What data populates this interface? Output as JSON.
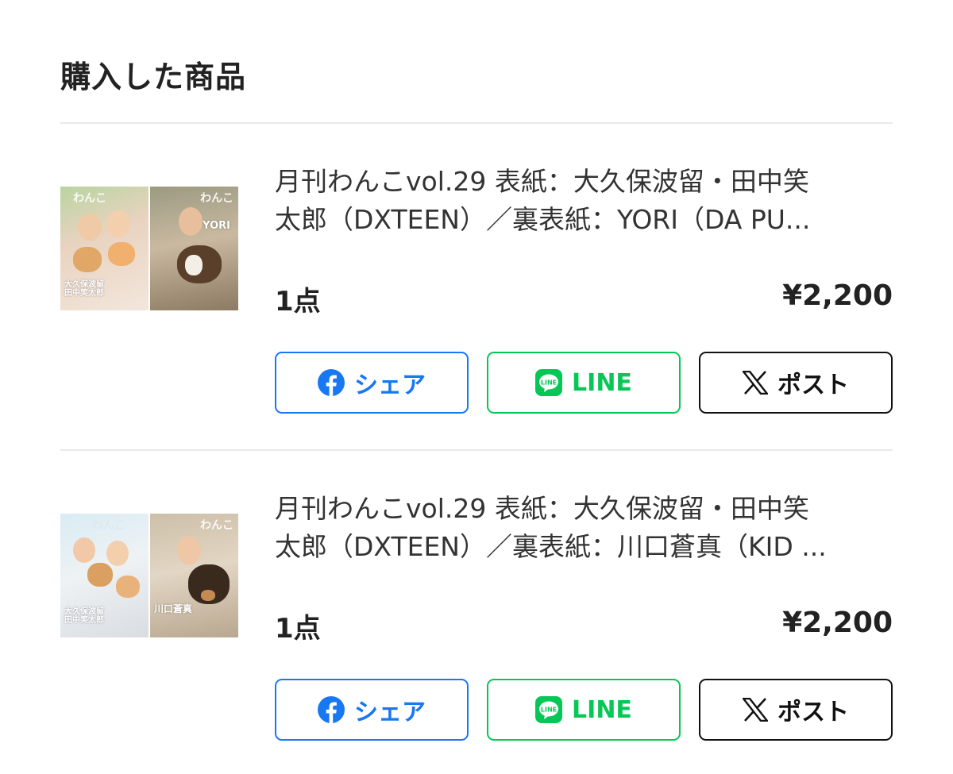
{
  "section": {
    "title": "購入した商品"
  },
  "items": [
    {
      "title_line1": "月刊わんこvol.29 表紙：大久保波留・田中笑",
      "title_line2": "太郎（DXTEEN）／裏表紙：YORI（DA PU...",
      "quantity": "1点",
      "price": "¥2,200",
      "cover_front_caption": "大久保波留\n田中笑太郎",
      "cover_back_caption": "YORI",
      "cover_mast": "わんこ"
    },
    {
      "title_line1": "月刊わんこvol.29 表紙：大久保波留・田中笑",
      "title_line2": "太郎（DXTEEN）／裏表紙：川口蒼真（KID ...",
      "quantity": "1点",
      "price": "¥2,200",
      "cover_front_caption": "大久保波留\n田中笑太郎",
      "cover_back_caption": "川口蒼真",
      "cover_mast": "わんこ"
    }
  ],
  "share": {
    "facebook_label": "シェア",
    "line_label": "LINE",
    "x_label": "ポスト"
  },
  "colors": {
    "facebook": "#1877f2",
    "line": "#06c755",
    "x": "#111111"
  },
  "icons": [
    "facebook-icon",
    "line-icon",
    "x-icon"
  ]
}
